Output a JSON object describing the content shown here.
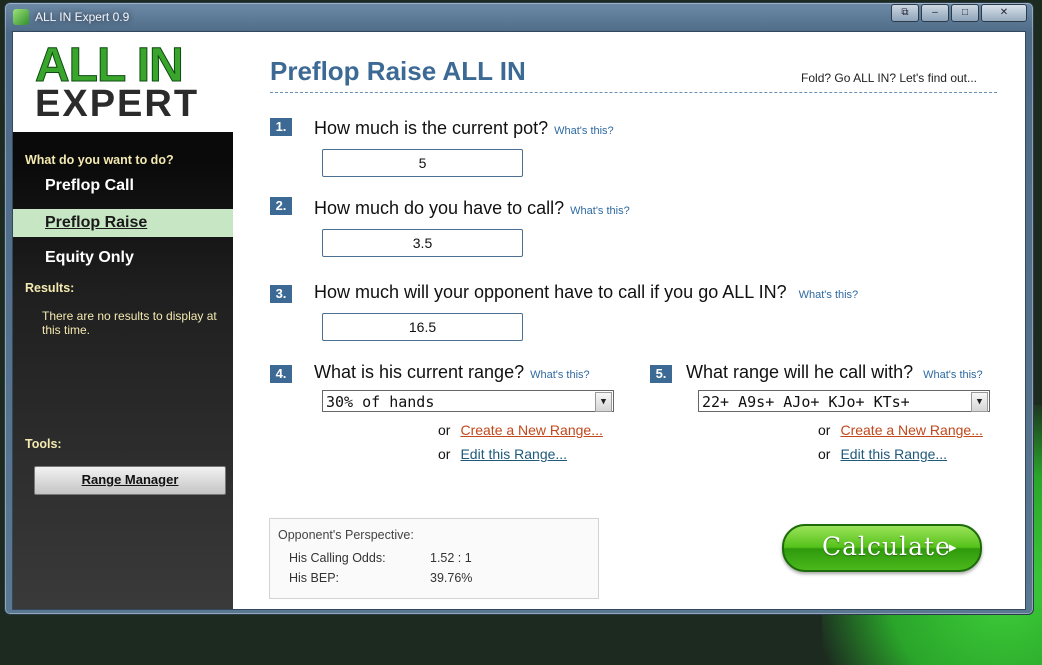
{
  "window": {
    "title": "ALL IN Expert 0.9",
    "buttons": [
      "⧉",
      "–",
      "□",
      "✕"
    ]
  },
  "sidebar": {
    "logo": {
      "line1": "ALL IN",
      "line2": "EXPERT"
    },
    "nav_heading": "What do you want to do?",
    "items": [
      {
        "label": "Preflop Call",
        "active": false
      },
      {
        "label": "Preflop Raise",
        "active": true
      },
      {
        "label": "Equity Only",
        "active": false
      }
    ],
    "results_heading": "Results:",
    "results_text": "There are no results to display at this time.",
    "tools_heading": "Tools:",
    "range_manager_label": "Range Manager"
  },
  "main": {
    "title": "Preflop Raise ALL IN",
    "tagline": "Fold? Go ALL IN? Let's find out...",
    "whats_this": "What's this?",
    "questions": [
      {
        "num": "1.",
        "text": "How much is the current pot?",
        "value": "5"
      },
      {
        "num": "2.",
        "text": "How much do you have to call?",
        "value": "3.5"
      },
      {
        "num": "3.",
        "text": "How much will your opponent have to call if you go ALL IN?",
        "value": "16.5"
      }
    ],
    "q4": {
      "num": "4.",
      "text": "What is his current range?",
      "selected": "30% of hands"
    },
    "q5": {
      "num": "5.",
      "text": "What range will he call with?",
      "selected": "22+ A9s+ AJo+ KJo+ KTs+"
    },
    "or_label": "or",
    "create_range_link": "Create a New Range...",
    "edit_range_link": "Edit this Range...",
    "perspective": {
      "title": "Opponent's Perspective:",
      "rows": [
        {
          "label": "His Calling Odds:",
          "value": "1.52 : 1"
        },
        {
          "label": "His BEP:",
          "value": "39.76%"
        }
      ]
    },
    "calculate_label": "Calculate",
    "calculate_arrow": "▸"
  },
  "colors": {
    "accent_blue": "#3c6a95",
    "logo_green": "#3aa52c",
    "active_nav_bg": "#c7e6c3",
    "link_orange": "#c2471a",
    "button_green": "#55c21a"
  }
}
